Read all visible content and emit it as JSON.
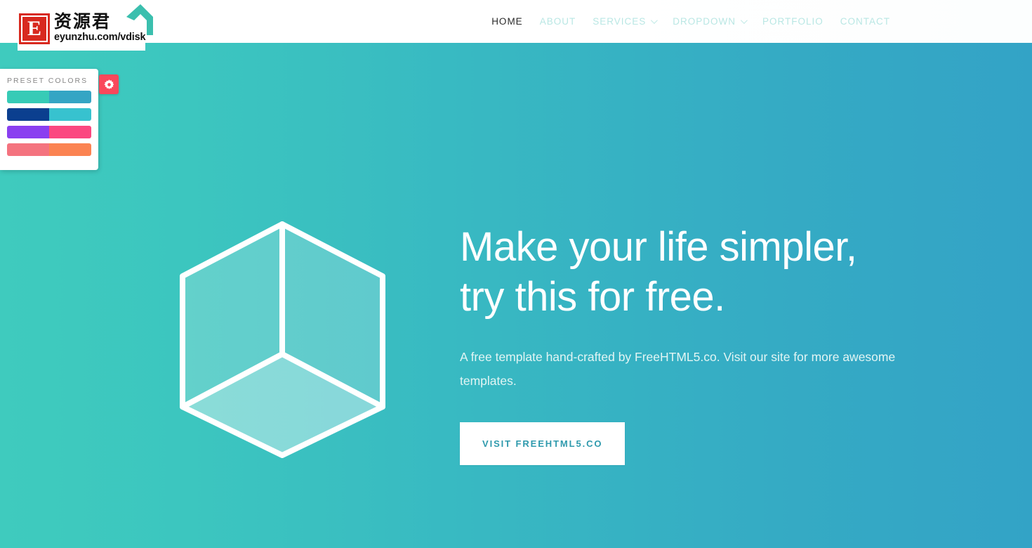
{
  "header": {
    "nav": [
      {
        "label": "HOME",
        "active": true,
        "has_caret": false
      },
      {
        "label": "ABOUT",
        "active": false,
        "has_caret": false
      },
      {
        "label": "SERVICES",
        "active": false,
        "has_caret": true
      },
      {
        "label": "DROPDOWN",
        "active": false,
        "has_caret": true
      },
      {
        "label": "PORTFOLIO",
        "active": false,
        "has_caret": false
      },
      {
        "label": "CONTACT",
        "active": false,
        "has_caret": false
      }
    ],
    "nav_active_color": "#2b2b2b",
    "nav_inactive_color": "#b9e7e4",
    "background": "#ffffff"
  },
  "watermark": {
    "mark_letter": "E",
    "mark_color": "#d8291f",
    "brand_cn": "资源君",
    "brand_url": "eyunzhu.com/vdisk",
    "arrow_icon": "arrow-up-left-icon",
    "arrow_color": "#3bbfae"
  },
  "preset_panel": {
    "title": "PRESET COLORS",
    "title_color": "#888888",
    "toggle_icon": "gear-icon",
    "toggle_color": "#f9485b",
    "swatches": [
      {
        "name": "teal-blue",
        "left": "#37cbb6",
        "right": "#35a5c4"
      },
      {
        "name": "navy-cyan",
        "left": "#0b3f8f",
        "right": "#37c2cf"
      },
      {
        "name": "purple-pink",
        "left": "#8a3ff0",
        "right": "#fb4880"
      },
      {
        "name": "salmon-orange",
        "left": "#f4737f",
        "right": "#fb8352"
      }
    ]
  },
  "hero": {
    "title_line1": "Make your life simpler,",
    "title_line2": "try this for free.",
    "subtitle": "A free template hand-crafted by FreeHTML5.co. Visit our site for more awesome templates.",
    "cta_label": "VISIT FREEHTML5.CO",
    "cta_text_color": "#2f9aad",
    "cta_background": "#ffffff",
    "title_color": "#ffffff",
    "subtitle_color": "#e2f5f4",
    "illustration": "isometric-cube-icon",
    "background_gradient_from": "#3fcbbe",
    "background_gradient_to": "#33a3c6"
  }
}
